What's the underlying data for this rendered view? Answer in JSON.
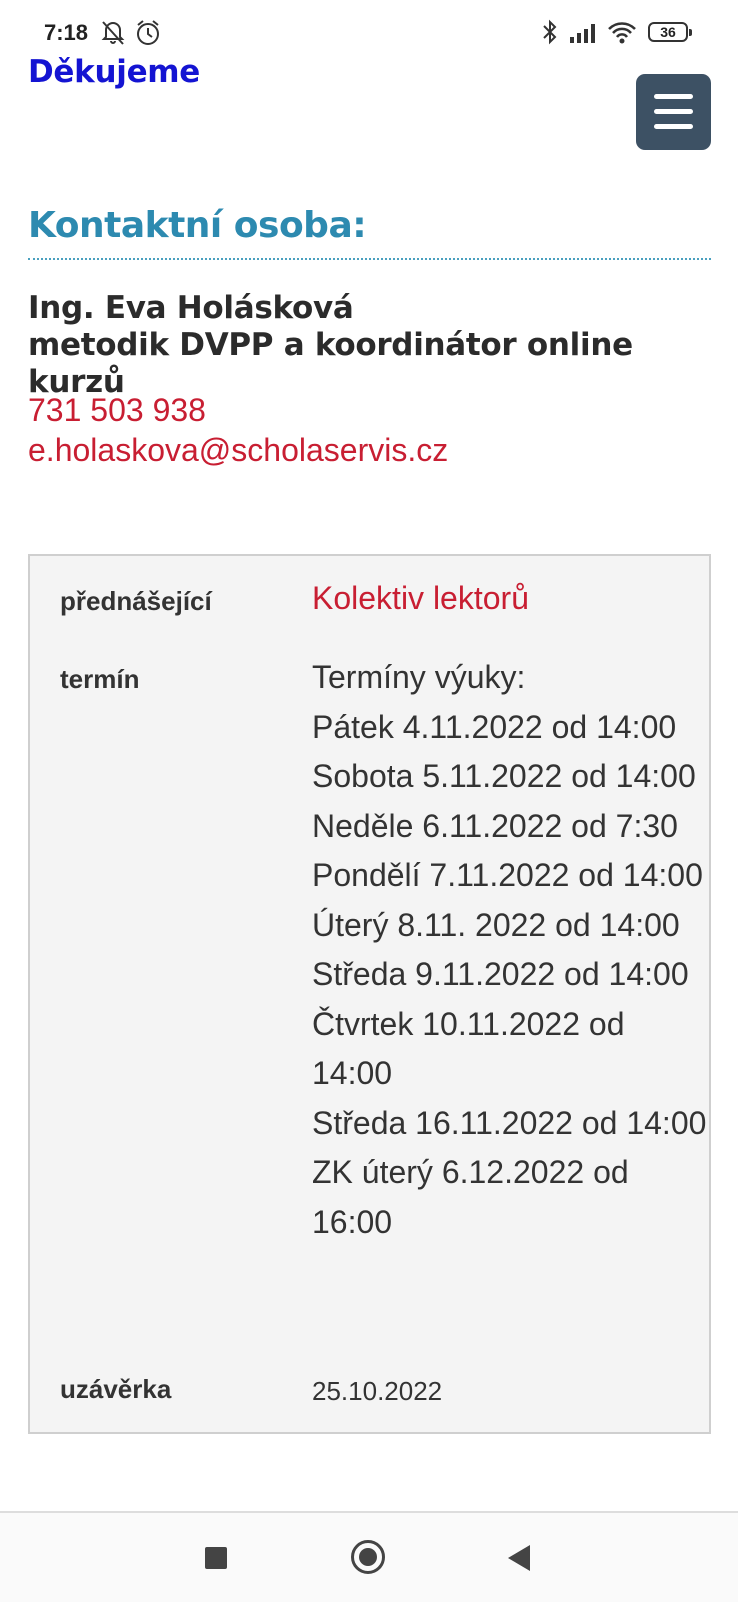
{
  "status_bar": {
    "time": "7:18",
    "battery": "36",
    "icons": [
      "bell-off-icon",
      "alarm-icon",
      "bluetooth-icon",
      "signal-icon",
      "wifi-icon",
      "battery-icon"
    ]
  },
  "header": {
    "brand": "Děkujeme",
    "menu_icon": "hamburger-menu-icon"
  },
  "contact": {
    "title": "Kontaktní osoba:",
    "name": "Ing. Eva Holásková",
    "role": "metodik DVPP a koordinátor online kurzů",
    "phone": "731 503 938",
    "email": "e.holaskova@scholaservis.cz"
  },
  "details": {
    "lecturer_label": "přednášející",
    "lecturer_value": "Kolektiv lektorů",
    "term_label": "termín",
    "term_lines": [
      "Termíny výuky:",
      "Pátek 4.11.2022 od 14:00",
      "Sobota 5.11.2022 od 14:00",
      "Neděle 6.11.2022 od 7:30",
      "Pondělí 7.11.2022 od 14:00",
      "Úterý 8.11. 2022 od 14:00",
      "Středa 9.11.2022 od 14:00",
      "Čtvrtek 10.11.2022 od 14:00",
      "Středa 16.11.2022 od 14:00",
      "ZK úterý 6.12.2022 od 16:00"
    ],
    "deadline_label": "uzávěrka",
    "deadline_value": "25.10.2022"
  },
  "colors": {
    "brand": "#1414d2",
    "heading": "#2d8ab0",
    "link": "#c81e32",
    "menu_button": "#3d5164"
  }
}
